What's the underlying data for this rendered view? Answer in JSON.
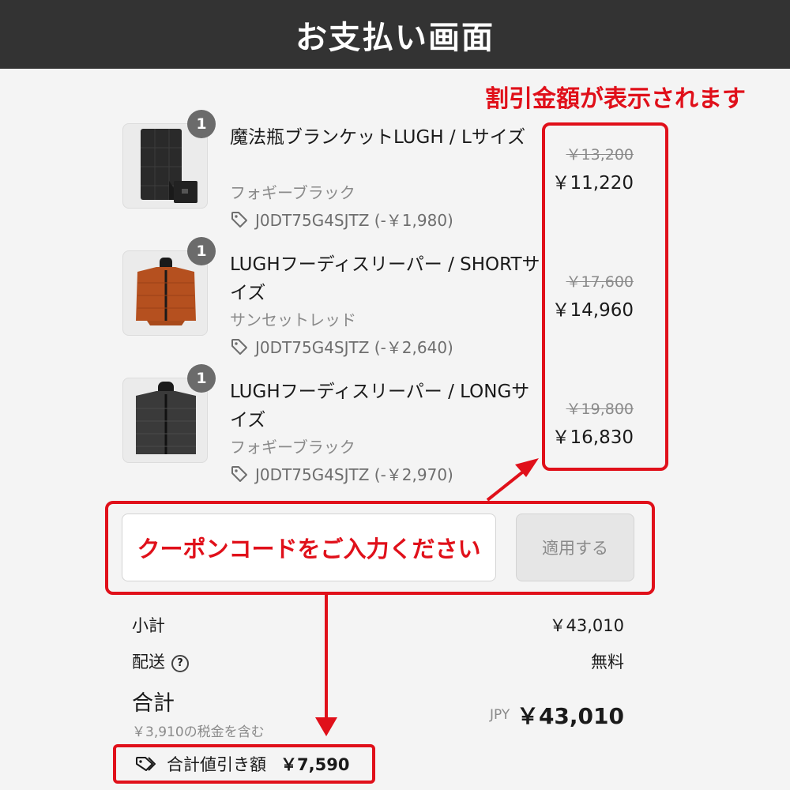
{
  "header": {
    "title": "お支払い画面"
  },
  "annotations": {
    "discount_note": "割引金額が表示されます"
  },
  "items": [
    {
      "qty": "1",
      "name": "魔法瓶ブランケットLUGH / Lサイズ",
      "variant": "フォギーブラック",
      "coupon": "J0DT75G4SJTZ (-￥1,980)",
      "original_price": "￥13,200",
      "price": "￥11,220"
    },
    {
      "qty": "1",
      "name": "LUGHフーディスリーパー / SHORTサイズ",
      "variant": "サンセットレッド",
      "coupon": "J0DT75G4SJTZ (-￥2,640)",
      "original_price": "￥17,600",
      "price": "￥14,960"
    },
    {
      "qty": "1",
      "name": "LUGHフーディスリーパー / LONGサイズ",
      "variant": "フォギーブラック",
      "coupon": "J0DT75G4SJTZ (-￥2,970)",
      "original_price": "￥19,800",
      "price": "￥16,830"
    }
  ],
  "coupon": {
    "placeholder": "クーポンコードをご入力ください",
    "apply_label": "適用する"
  },
  "summary": {
    "subtotal_label": "小計",
    "subtotal_value": "￥43,010",
    "shipping_label": "配送",
    "shipping_help_icon": "?",
    "shipping_value": "無料",
    "total_label": "合計",
    "tax_note": "￥3,910の税金を含む",
    "currency": "JPY",
    "total_value": "￥43,010",
    "discount_label": "合計値引き額",
    "discount_value": "￥7,590"
  },
  "icons": {
    "tag": "tag-icon",
    "help": "question-circle-icon"
  },
  "colors": {
    "header_bg": "#333333",
    "accent_red": "#e0101a",
    "muted_text": "#8a8a8a"
  }
}
